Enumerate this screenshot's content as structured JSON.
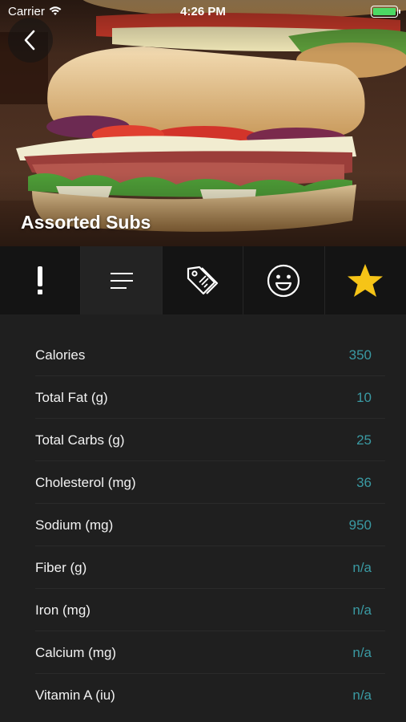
{
  "status_bar": {
    "carrier": "Carrier",
    "time": "4:26 PM",
    "battery_color": "#4cd964"
  },
  "hero": {
    "title": "Assorted Subs",
    "image_subject": "sandwich"
  },
  "back_button": {
    "icon": "chevron-left-icon"
  },
  "tabs": [
    {
      "icon": "exclamation-icon",
      "active": false
    },
    {
      "icon": "menu-lines-icon",
      "active": true
    },
    {
      "icon": "price-tags-icon",
      "active": false
    },
    {
      "icon": "smiley-face-icon",
      "active": false
    },
    {
      "icon": "star-icon",
      "active": false
    }
  ],
  "colors": {
    "accent_value": "#3a9aa3",
    "star": "#f6c417",
    "background": "#1f1f1f"
  },
  "nutrition": [
    {
      "label": "Calories",
      "value": "350"
    },
    {
      "label": "Total Fat (g)",
      "value": "10"
    },
    {
      "label": "Total Carbs (g)",
      "value": "25"
    },
    {
      "label": "Cholesterol (mg)",
      "value": "36"
    },
    {
      "label": "Sodium (mg)",
      "value": "950"
    },
    {
      "label": "Fiber (g)",
      "value": "n/a"
    },
    {
      "label": "Iron (mg)",
      "value": "n/a"
    },
    {
      "label": "Calcium (mg)",
      "value": "n/a"
    },
    {
      "label": "Vitamin A (iu)",
      "value": "n/a"
    }
  ]
}
